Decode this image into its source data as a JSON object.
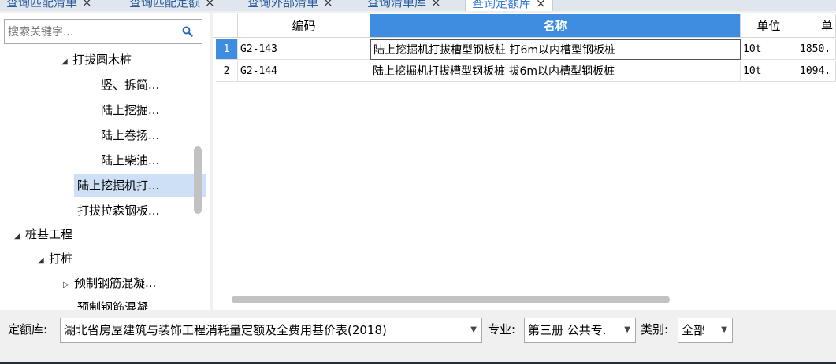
{
  "tabs": [
    {
      "label": "查询匹配清单"
    },
    {
      "label": "查询匹配定额"
    },
    {
      "label": "查询外部清单"
    },
    {
      "label": "查询清单库"
    },
    {
      "label": "查询定额库"
    }
  ],
  "tab_close": "×",
  "search": {
    "placeholder": "搜索关键字..."
  },
  "tree": [
    {
      "label": "打拔圆木桩",
      "arrow": "◢"
    },
    {
      "label": "竖、拆简..."
    },
    {
      "label": "陆上挖掘..."
    },
    {
      "label": "陆上卷扬..."
    },
    {
      "label": "陆上柴油..."
    },
    {
      "label": "陆上挖掘机打..."
    },
    {
      "label": "打拔拉森钢板..."
    },
    {
      "label": "桩基工程",
      "arrow": "◢"
    },
    {
      "label": "打桩",
      "arrow": "◢"
    },
    {
      "label": "预制钢筋混凝...",
      "arrow": "▷"
    },
    {
      "label": "预制钢筋混凝..."
    }
  ],
  "grid": {
    "headers": {
      "code": "编码",
      "name": "名称",
      "unit": "单位",
      "price": "单"
    },
    "rows": [
      {
        "num": "1",
        "code": "G2-143",
        "name": "陆上挖掘机打拔槽型钢板桩 打6m以内槽型钢板桩",
        "unit": "10t",
        "price": "1850."
      },
      {
        "num": "2",
        "code": "G2-144",
        "name": "陆上挖掘机打拔槽型钢板桩 拔6m以内槽型钢板桩",
        "unit": "10t",
        "price": "1094."
      }
    ]
  },
  "filters": {
    "library_label": "定额库:",
    "library_value": "湖北省房屋建筑与装饰工程消耗量定额及全费用基价表(2018)",
    "major_label": "专业:",
    "major_value": "第三册 公共专.",
    "category_label": "类别:",
    "category_value": "全部"
  },
  "colors": {
    "accent": "#3e8de0",
    "selection": "#cde0f5"
  }
}
